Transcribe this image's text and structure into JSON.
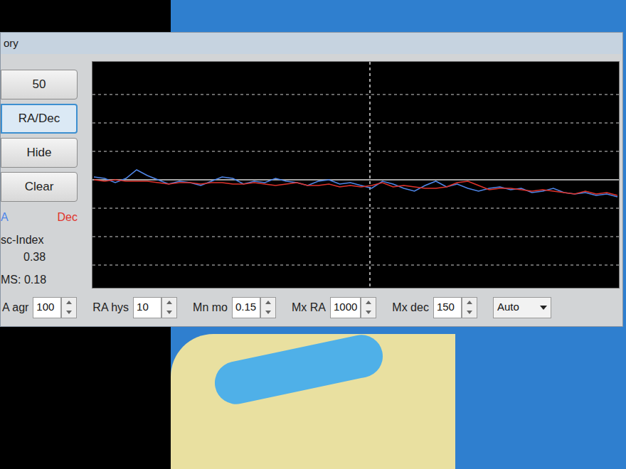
{
  "window": {
    "title": "ory"
  },
  "buttons": [
    {
      "label": "50",
      "selected": false
    },
    {
      "label": "RA/Dec",
      "selected": true
    },
    {
      "label": "Hide",
      "selected": false
    },
    {
      "label": "Clear",
      "selected": false
    }
  ],
  "legend": [
    {
      "label": "A",
      "color": "#4f86e8"
    },
    {
      "label": "Dec",
      "color": "#e0332b"
    }
  ],
  "stats": {
    "osc_label": "sc-Index",
    "osc_value": "0.38",
    "rms": "MS: 0.18"
  },
  "chart": {
    "series": [
      {
        "color": "#4f86e8",
        "values": [
          0.1,
          0.05,
          -0.1,
          0.05,
          0.35,
          0.15,
          0.0,
          -0.15,
          -0.05,
          -0.1,
          -0.2,
          -0.05,
          0.1,
          0.05,
          -0.15,
          -0.05,
          -0.1,
          0.05,
          -0.05,
          -0.1,
          -0.2,
          -0.05,
          0.0,
          -0.15,
          -0.1,
          -0.2,
          -0.3,
          -0.05,
          -0.15,
          -0.3,
          -0.4,
          -0.2,
          -0.05,
          -0.25,
          -0.15,
          -0.3,
          -0.4,
          -0.3,
          -0.25,
          -0.35,
          -0.3,
          -0.45,
          -0.4,
          -0.3,
          -0.45,
          -0.5,
          -0.45,
          -0.55,
          -0.5,
          -0.6
        ]
      },
      {
        "color": "#e0332b",
        "values": [
          0.0,
          -0.05,
          0.0,
          -0.05,
          -0.05,
          -0.05,
          -0.1,
          -0.15,
          -0.1,
          -0.1,
          -0.15,
          -0.1,
          -0.1,
          -0.15,
          -0.15,
          -0.1,
          -0.15,
          -0.2,
          -0.15,
          -0.1,
          -0.2,
          -0.2,
          -0.15,
          -0.25,
          -0.2,
          -0.25,
          -0.2,
          -0.1,
          -0.25,
          -0.2,
          -0.25,
          -0.3,
          -0.3,
          -0.25,
          -0.1,
          -0.05,
          -0.2,
          -0.35,
          -0.3,
          -0.3,
          -0.35,
          -0.4,
          -0.35,
          -0.4,
          -0.45,
          -0.5,
          -0.4,
          -0.5,
          -0.45,
          -0.55
        ]
      }
    ]
  },
  "controls": [
    {
      "label": "A agr",
      "value": "100"
    },
    {
      "label": "RA hys",
      "value": "10"
    },
    {
      "label": "Mn mo",
      "value": "0.15"
    },
    {
      "label": "Mx RA",
      "value": "1000"
    },
    {
      "label": "Mx dec",
      "value": "150"
    }
  ],
  "dropdown": {
    "value": "Auto"
  }
}
